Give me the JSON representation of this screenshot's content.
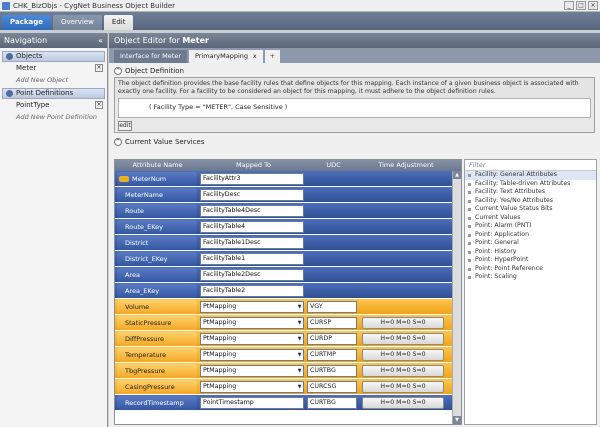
{
  "window": {
    "title": "CHK_BizObjs - CygNet Business Object Builder"
  },
  "ribbon": {
    "tabs": [
      "Package",
      "Overview",
      "Edit"
    ]
  },
  "nav": {
    "title": "Navigation",
    "collapse_glyph": "«",
    "objects_label": "Objects",
    "object_item": "Meter",
    "add_object": "Add New Object",
    "pointdefs_label": "Point Definitions",
    "pointdef_item": "PointType",
    "add_pointdef": "Add New Point Definition"
  },
  "editor": {
    "title_prefix": "Object Editor for",
    "title_object": "Meter",
    "tabs": [
      "Interface for Meter",
      "PrimaryMapping",
      "+"
    ],
    "tab_close": "x"
  },
  "object_definition": {
    "label": "Object Definition",
    "description": "The object definition provides the base facility rules that define objects for this mapping. Each instance of a given business object is associated with exactly one facility. For a facility to be considered an object for this mapping, it must adhere to the object definition rules.",
    "expression": "( Facility Type = \"METER\", Case Sensitive )",
    "edit_label": "edit"
  },
  "cvs": {
    "label": "Current Value Services",
    "columns": [
      "Attribute Name",
      "Mapped To",
      "UDC",
      "Time Adjustment"
    ],
    "rows": [
      {
        "attr": "MeterNum",
        "mapped": "FacilityAttr3",
        "udc": "",
        "time": "",
        "kind": "blue",
        "key": true,
        "dropdown": false
      },
      {
        "attr": "MeterName",
        "mapped": "FacilityDesc",
        "udc": "",
        "time": "",
        "kind": "blue",
        "key": false,
        "dropdown": false
      },
      {
        "attr": "Route",
        "mapped": "FacilityTable4Desc",
        "udc": "",
        "time": "",
        "kind": "blue",
        "key": false,
        "dropdown": false
      },
      {
        "attr": "Route_EKey",
        "mapped": "FacilityTable4",
        "udc": "",
        "time": "",
        "kind": "blue",
        "key": false,
        "dropdown": false
      },
      {
        "attr": "District",
        "mapped": "FacilityTable1Desc",
        "udc": "",
        "time": "",
        "kind": "blue",
        "key": false,
        "dropdown": false
      },
      {
        "attr": "District_EKey",
        "mapped": "FacilityTable1",
        "udc": "",
        "time": "",
        "kind": "blue",
        "key": false,
        "dropdown": false
      },
      {
        "attr": "Area",
        "mapped": "FacilityTable2Desc",
        "udc": "",
        "time": "",
        "kind": "blue",
        "key": false,
        "dropdown": false
      },
      {
        "attr": "Area_EKey",
        "mapped": "FacilityTable2",
        "udc": "",
        "time": "",
        "kind": "blue",
        "key": false,
        "dropdown": false
      },
      {
        "attr": "Volume",
        "mapped": "PtMapping",
        "udc": "VGY",
        "time": "",
        "kind": "orange",
        "key": false,
        "dropdown": true
      },
      {
        "attr": "StaticPressure",
        "mapped": "PtMapping",
        "udc": "CURSP",
        "time": "H=0 M=0 S=0",
        "kind": "orange",
        "key": false,
        "dropdown": true
      },
      {
        "attr": "DiffPressure",
        "mapped": "PtMapping",
        "udc": "CURDP",
        "time": "H=0 M=0 S=0",
        "kind": "orange",
        "key": false,
        "dropdown": true
      },
      {
        "attr": "Temperature",
        "mapped": "PtMapping",
        "udc": "CURTMP",
        "time": "H=0 M=0 S=0",
        "kind": "orange",
        "key": false,
        "dropdown": true
      },
      {
        "attr": "TbgPressure",
        "mapped": "PtMapping",
        "udc": "CURTBG",
        "time": "H=0 M=0 S=0",
        "kind": "orange",
        "key": false,
        "dropdown": true
      },
      {
        "attr": "CasingPressure",
        "mapped": "PtMapping",
        "udc": "CURCSG",
        "time": "H=0 M=0 S=0",
        "kind": "orange",
        "key": false,
        "dropdown": true
      },
      {
        "attr": "RecordTimestamp",
        "mapped": "PointTimestamp",
        "udc": "CURTBG",
        "time": "H=0 M=0 S=0",
        "kind": "blue",
        "key": false,
        "dropdown": false
      }
    ]
  },
  "filter": {
    "placeholder": "Filter",
    "items": [
      "Facility: General Attributes",
      "Facility: Table-driven Attributes",
      "Facility: Text Attributes",
      "Facility: Yes/No Attributes",
      "Current Value Status Bits",
      "Current Values",
      "Point: Alarm (PNT)",
      "Point: Application",
      "Point: General",
      "Point: History",
      "Point: HyperPoint",
      "Point: Point Reference",
      "Point: Scaling"
    ]
  }
}
